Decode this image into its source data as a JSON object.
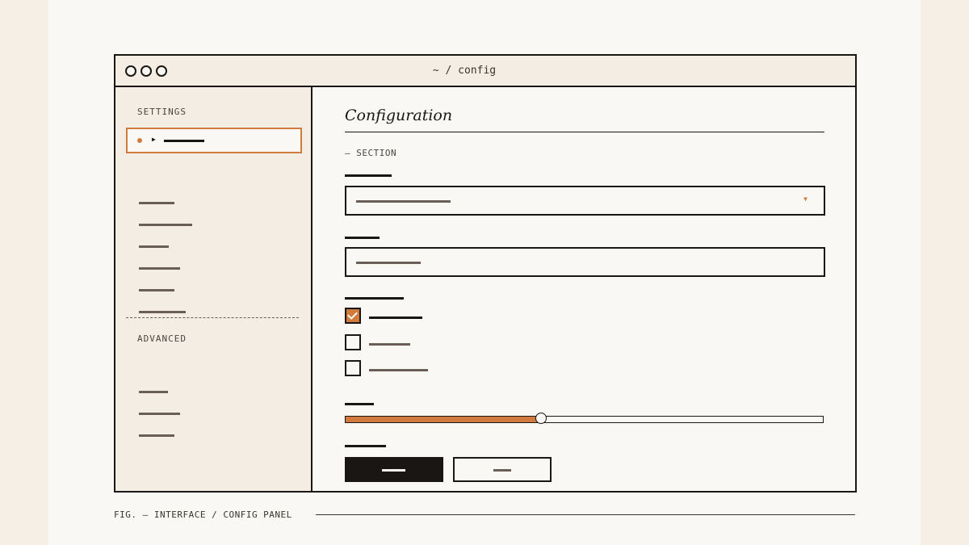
{
  "window": {
    "title": "~ / config"
  },
  "sidebar": {
    "settings_label": "SETTINGS",
    "advanced_label": "ADVANCED",
    "active_item_marker": "▶"
  },
  "main": {
    "heading": "Configuration",
    "section_label": "— SECTION",
    "dropdown_arrow": "▼",
    "checkboxes": [
      {
        "checked": true
      },
      {
        "checked": false
      },
      {
        "checked": false
      }
    ],
    "slider": {
      "value_fraction": 0.41
    }
  },
  "caption": "FIG. — INTERFACE / CONFIG PANEL",
  "colors": {
    "accent": "#d07a3e",
    "ink": "#1a1613",
    "panel": "#f3ede4",
    "paper": "#faf8f4"
  },
  "icons": {
    "window_controls": "circle-icon",
    "active_marker": "play-triangle-icon",
    "dropdown": "chevron-down-icon",
    "checkbox_checked": "check-icon"
  }
}
